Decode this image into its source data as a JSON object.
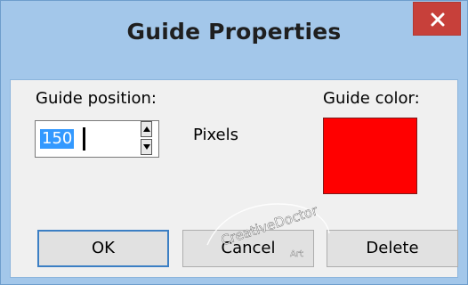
{
  "dialog": {
    "title": "Guide Properties"
  },
  "position": {
    "label": "Guide position:",
    "value": "150",
    "unit": "Pixels"
  },
  "color": {
    "label": "Guide color:",
    "swatch": "#ff0000"
  },
  "buttons": {
    "ok": "OK",
    "cancel": "Cancel",
    "delete": "Delete"
  },
  "icons": {
    "close": "close-icon",
    "up": "spin-up-arrow-icon",
    "down": "spin-down-arrow-icon"
  },
  "watermark": {
    "text_line1": "CreativeDoctor",
    "text_line2": "Art"
  }
}
